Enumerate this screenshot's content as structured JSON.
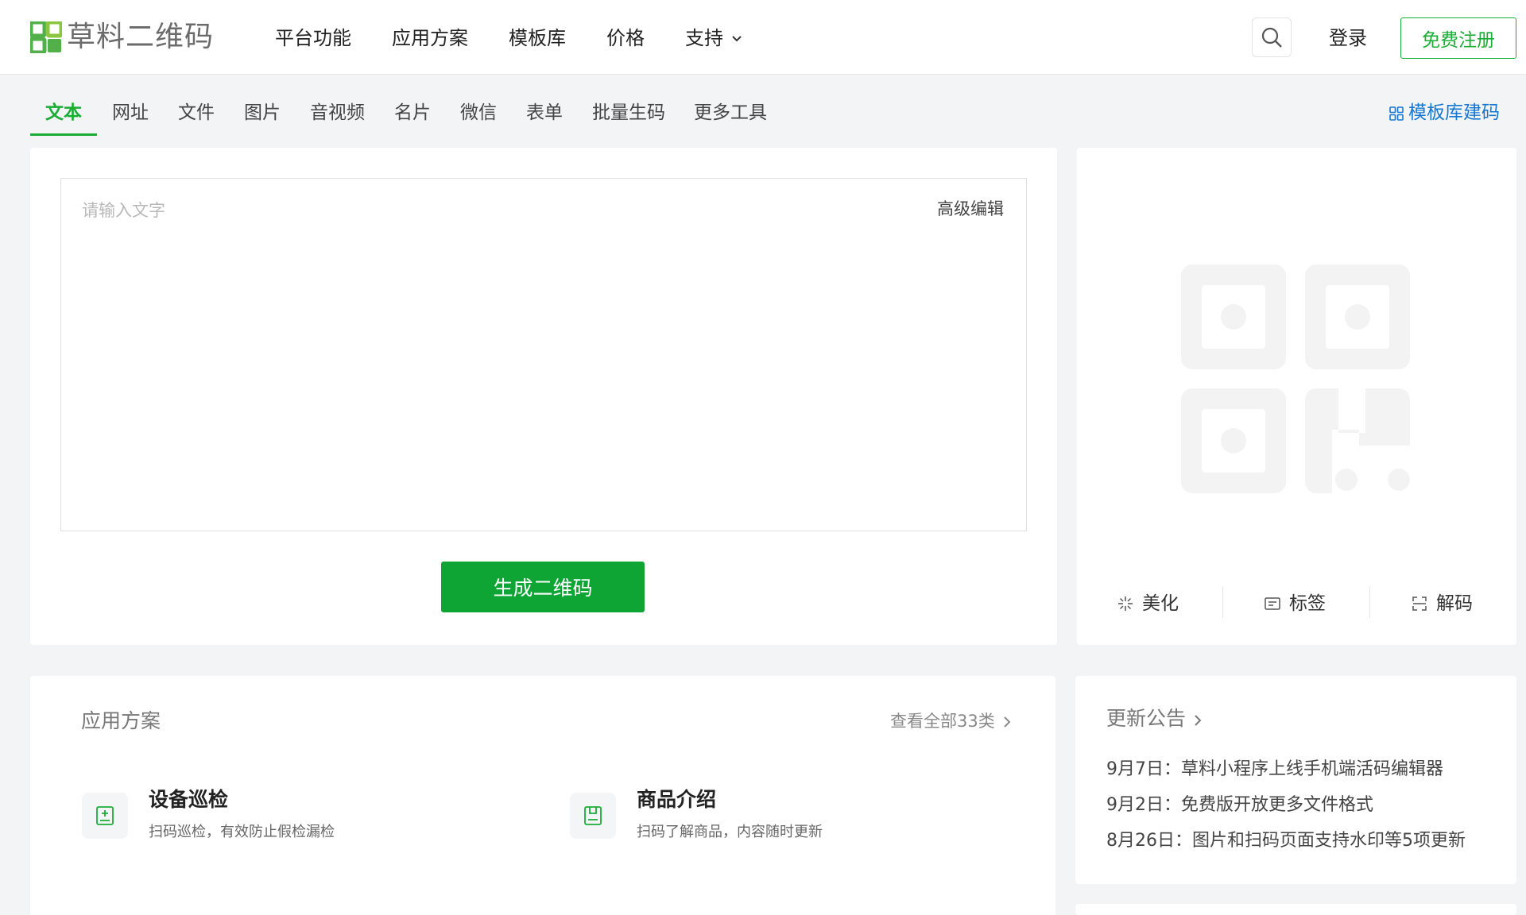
{
  "brand": {
    "name": "草料二维码",
    "accent": "#1aad36",
    "logo_colors": [
      "#52b04b",
      "#8cc63f"
    ]
  },
  "header": {
    "nav": [
      {
        "label": "平台功能"
      },
      {
        "label": "应用方案"
      },
      {
        "label": "模板库"
      },
      {
        "label": "价格"
      },
      {
        "label": "支持",
        "icon": "chevron-down-icon"
      }
    ],
    "search_icon": "search-icon",
    "login": "登录",
    "register": "免费注册"
  },
  "tabs": {
    "items": [
      "文本",
      "网址",
      "文件",
      "图片",
      "音视频",
      "名片",
      "微信",
      "表单",
      "批量生码",
      "更多工具"
    ],
    "active": "文本",
    "template_link": "模板库建码",
    "template_icon": "grid-icon"
  },
  "editor": {
    "placeholder": "请输入文字",
    "advanced_edit": "高级编辑",
    "generate": "生成二维码"
  },
  "preview": {
    "tools": [
      {
        "label": "美化",
        "icon": "sparkle-icon"
      },
      {
        "label": "标签",
        "icon": "label-icon"
      },
      {
        "label": "解码",
        "icon": "scan-icon"
      }
    ]
  },
  "solutions": {
    "title": "应用方案",
    "see_all": "查看全部33类",
    "items": [
      {
        "title": "设备巡检",
        "desc": "扫码巡检，有效防止假检漏检",
        "icon": "device-icon"
      },
      {
        "title": "商品介绍",
        "desc": "扫码了解商品，内容随时更新",
        "icon": "product-icon"
      }
    ]
  },
  "announcements": {
    "title": "更新公告",
    "items": [
      "9月7日：草料小程序上线手机端活码编辑器",
      "9月2日：免费版开放更多文件格式",
      "8月26日：图片和扫码页面支持水印等5项更新"
    ]
  }
}
